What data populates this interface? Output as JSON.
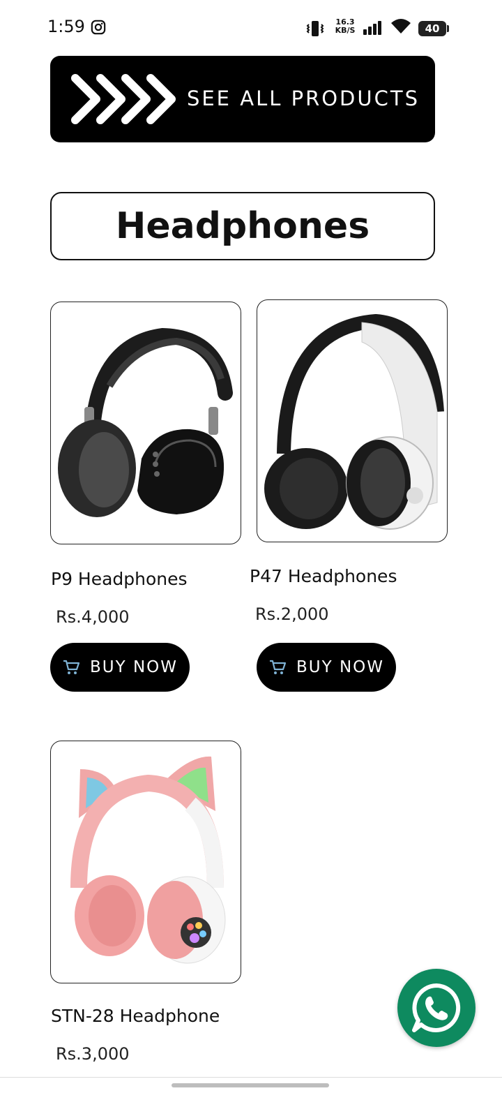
{
  "status_bar": {
    "time": "1:59",
    "network_speed_value": "16.3",
    "network_speed_unit": "KB/S",
    "battery_level": "40",
    "icons": [
      "instagram-icon",
      "vibrate-icon",
      "signal-icon",
      "wifi-icon",
      "battery-icon"
    ]
  },
  "banner": {
    "label": "SEE ALL PRODUCTS",
    "icon": "chevrons-right-icon"
  },
  "section": {
    "title": "Headphones"
  },
  "products": [
    {
      "name": "P9 Headphones",
      "price": "Rs.4,000",
      "button_label": "BUY NOW"
    },
    {
      "name": "P47 Headphones",
      "price": "Rs.2,000",
      "button_label": "BUY NOW"
    },
    {
      "name": "STN-28 Headphone",
      "price": "Rs.3,000"
    }
  ],
  "floating_action": {
    "icon": "whatsapp-icon",
    "color": "#0e8a5f"
  },
  "colors": {
    "background": "#ffffff",
    "button": "#000000",
    "text": "#111111"
  }
}
